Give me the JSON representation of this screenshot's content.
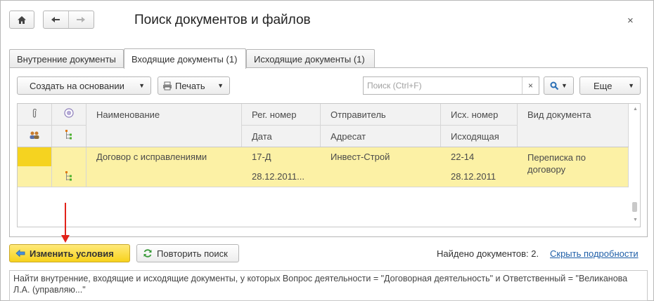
{
  "window": {
    "title": "Поиск документов и файлов",
    "close_glyph": "×",
    "home_icon": "home-icon",
    "back_icon": "arrow-left-icon",
    "forward_icon": "arrow-right-icon"
  },
  "tabs": [
    {
      "label": "Внутренние документы",
      "active": false
    },
    {
      "label": "Входящие документы (1)",
      "active": true
    },
    {
      "label": "Исходящие документы (1)",
      "active": false
    }
  ],
  "toolbar": {
    "create_label": "Создать на основании",
    "print_label": "Печать",
    "search_placeholder": "Поиск (Ctrl+F)",
    "clear_glyph": "×",
    "more_label": "Еще"
  },
  "table": {
    "headers_row1": [
      "Наименование",
      "Рег. номер",
      "Отправитель",
      "Исх. номер",
      "Вид документа"
    ],
    "headers_row2": [
      "Дата",
      "Адресат",
      "Исходящая"
    ],
    "rows": [
      {
        "name": "Договор с исправлениями",
        "reg_number": "17-Д",
        "date": "28.12.2011...",
        "sender": "Инвест-Строй",
        "addressee": "",
        "out_number": "22-14",
        "out_date": "28.12.2011",
        "doc_type": "Переписка по договору"
      }
    ]
  },
  "actions": {
    "change_conditions_label": "Изменить условия",
    "repeat_search_label": "Повторить поиск",
    "found_text": "Найдено документов: 2.",
    "hide_details_link": "Скрыть подробности"
  },
  "description": "Найти внутренние, входящие и исходящие документы, у которых Вопрос деятельности = \"Договорная деятельность\" и Ответственный = \"Великанова Л.А. (управляю...\"",
  "colors": {
    "selected_row": "#fcf1a5",
    "selected_cell": "#f5d320",
    "accent_button": "#f7d21c",
    "link": "#1f5fa8",
    "annotation_arrow": "#e2231a"
  }
}
